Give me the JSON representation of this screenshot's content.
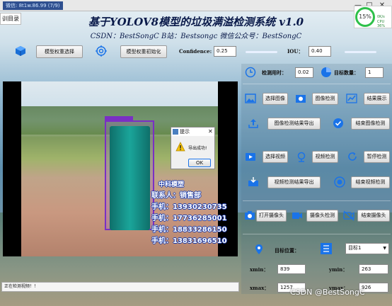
{
  "window": {
    "title": "微信: 8t1w.86.99 (7/9)",
    "menu_tab": "训目录",
    "controls": [
      "—",
      "□",
      "✕"
    ]
  },
  "net_meter": {
    "percent": "15%",
    "up": "0K/s",
    "cpu": "CPU 36%"
  },
  "header": {
    "title": "基于YOLOV8模型的垃圾满溢检测系统 v1.0",
    "subtitle": "CSDN：BestSongC   B站：Bestsongc   微信公众号：BestSongC"
  },
  "toolbar": {
    "model_select": "模型权重选择",
    "model_init": "模型权重初始化",
    "confidence_label": "Confidence:",
    "confidence_value": "0.25",
    "iou_label": "IOU：",
    "iou_value": "0.40"
  },
  "stats": {
    "time_label": "检测用时：",
    "time_value": "0.02",
    "count_label": "目标数量：",
    "count_value": "1"
  },
  "actions": {
    "select_image": "选择图像",
    "image_detect": "图像检测",
    "show_result": "结果展示",
    "export_image": "图像检测结果导出",
    "end_image": "结束图像检测",
    "select_video": "选择视频",
    "video_detect": "视频检测",
    "pause_detect": "暂停检测",
    "export_video": "视频检测结果导出",
    "end_video": "结束视频检测",
    "open_camera": "打开摄像头",
    "camera_detect": "摄像头检测",
    "end_camera": "结束摄像头"
  },
  "target": {
    "position_label": "目标位置：",
    "select_value": "目标1",
    "xmin_label": "xmin：",
    "xmin_value": "839",
    "ymin_label": "ymin：",
    "ymin_value": "263",
    "xmax_label": "xmax：",
    "xmax_value": "1257",
    "ymax_label": "ymax：",
    "ymax_value": "926"
  },
  "msgbox": {
    "title": "提示",
    "message": "导出成功!",
    "ok": "OK"
  },
  "video_watermark": {
    "line1": "中科模塑",
    "line2": "联系人：销售部",
    "line3": "手机：13930230735",
    "line4": "手机：17736285001",
    "line5": "手机：18833286150",
    "line6": "手机：13831696510"
  },
  "status": {
    "text": "正在检测视频！！"
  },
  "footer": {
    "watermark": "CSDN @BestSongC"
  },
  "colors": {
    "accent": "#1a73e8",
    "bbox": "#7a2fc4",
    "meter": "#2ec04a"
  }
}
